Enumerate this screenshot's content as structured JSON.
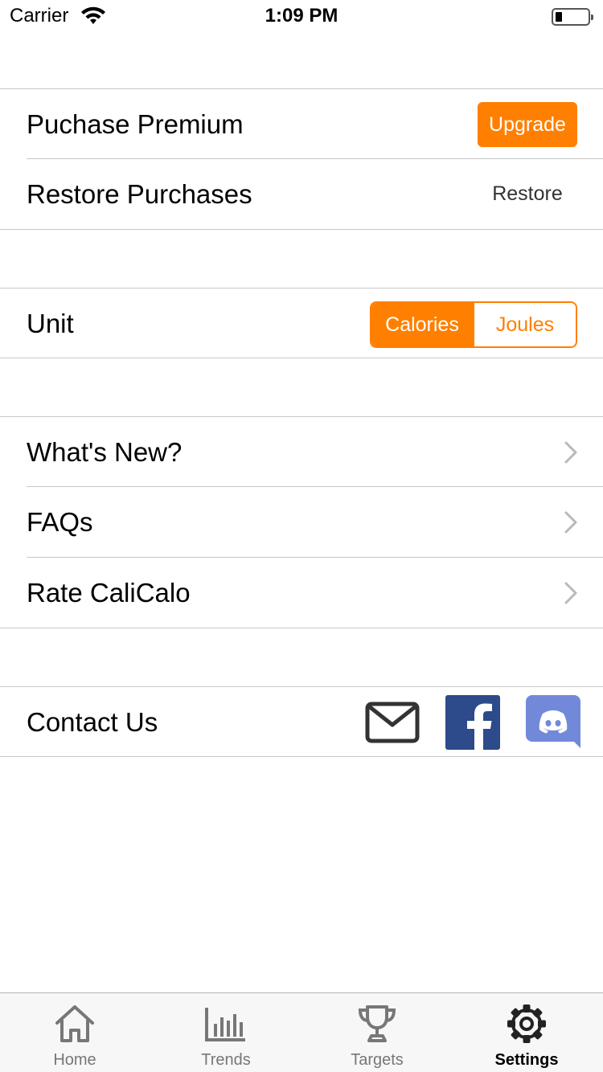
{
  "status_bar": {
    "carrier": "Carrier",
    "time": "1:09 PM"
  },
  "purchase": {
    "premium_label": "Puchase Premium",
    "upgrade_button": "Upgrade",
    "restore_label": "Restore Purchases",
    "restore_button": "Restore"
  },
  "unit": {
    "label": "Unit",
    "options": [
      "Calories",
      "Joules"
    ],
    "selected": "Calories"
  },
  "info": {
    "whats_new": "What's New?",
    "faqs": "FAQs",
    "rate": "Rate CaliCalo"
  },
  "contact": {
    "label": "Contact Us",
    "icons": [
      "mail-icon",
      "facebook-icon",
      "discord-icon"
    ]
  },
  "tab_bar": {
    "tabs": [
      {
        "label": "Home",
        "icon": "home-icon"
      },
      {
        "label": "Trends",
        "icon": "bar-chart-icon"
      },
      {
        "label": "Targets",
        "icon": "trophy-icon"
      },
      {
        "label": "Settings",
        "icon": "gear-icon"
      }
    ],
    "active": "Settings"
  },
  "colors": {
    "accent": "#ff7f00",
    "facebook": "#2d4a8a",
    "discord": "#7289da",
    "separator": "#c8c7cc"
  }
}
